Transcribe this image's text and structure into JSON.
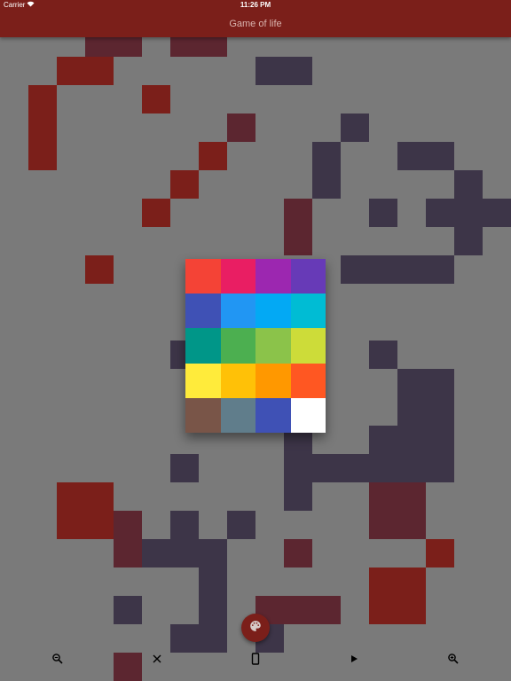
{
  "status_bar": {
    "carrier": "Carrier",
    "time": "11:26 PM",
    "wifi_icon": "wifi-icon"
  },
  "app_bar": {
    "title": "Game of life"
  },
  "colors": {
    "bar": "#7b1f1a",
    "background": "#7a7a7a",
    "red_cell": "#7b1f1a",
    "purple_cell": "#3d3548",
    "dark_red_cell": "#5c2630"
  },
  "board": {
    "cell_size": 32,
    "cells": [
      [
        "dark_red_cell",
        3,
        1
      ],
      [
        "dark_red_cell",
        4,
        1
      ],
      [
        "dark_red_cell",
        6,
        1
      ],
      [
        "dark_red_cell",
        7,
        1
      ],
      [
        "red_cell",
        2,
        2
      ],
      [
        "red_cell",
        3,
        2
      ],
      [
        "purple_cell",
        9,
        2
      ],
      [
        "purple_cell",
        10,
        2
      ],
      [
        "red_cell",
        1,
        3
      ],
      [
        "red_cell",
        5,
        3
      ],
      [
        "red_cell",
        1,
        4
      ],
      [
        "dark_red_cell",
        8,
        4
      ],
      [
        "purple_cell",
        12,
        4
      ],
      [
        "red_cell",
        1,
        5
      ],
      [
        "red_cell",
        7,
        5
      ],
      [
        "purple_cell",
        11,
        5
      ],
      [
        "purple_cell",
        14,
        5
      ],
      [
        "purple_cell",
        15,
        5
      ],
      [
        "red_cell",
        6,
        6
      ],
      [
        "purple_cell",
        11,
        6
      ],
      [
        "purple_cell",
        16,
        6
      ],
      [
        "red_cell",
        5,
        7
      ],
      [
        "dark_red_cell",
        10,
        7
      ],
      [
        "purple_cell",
        13,
        7
      ],
      [
        "purple_cell",
        15,
        7
      ],
      [
        "purple_cell",
        16,
        7
      ],
      [
        "purple_cell",
        17,
        7
      ],
      [
        "dark_red_cell",
        10,
        8
      ],
      [
        "purple_cell",
        16,
        8
      ],
      [
        "red_cell",
        3,
        9
      ],
      [
        "purple_cell",
        12,
        9
      ],
      [
        "purple_cell",
        13,
        9
      ],
      [
        "purple_cell",
        14,
        9
      ],
      [
        "purple_cell",
        15,
        9
      ],
      [
        "purple_cell",
        6,
        12
      ],
      [
        "purple_cell",
        13,
        12
      ],
      [
        "purple_cell",
        14,
        13
      ],
      [
        "purple_cell",
        15,
        13
      ],
      [
        "purple_cell",
        14,
        14
      ],
      [
        "purple_cell",
        15,
        14
      ],
      [
        "purple_cell",
        10,
        15
      ],
      [
        "purple_cell",
        13,
        15
      ],
      [
        "purple_cell",
        14,
        15
      ],
      [
        "purple_cell",
        15,
        15
      ],
      [
        "purple_cell",
        6,
        16
      ],
      [
        "purple_cell",
        10,
        16
      ],
      [
        "purple_cell",
        11,
        16
      ],
      [
        "purple_cell",
        12,
        16
      ],
      [
        "purple_cell",
        13,
        16
      ],
      [
        "purple_cell",
        14,
        16
      ],
      [
        "purple_cell",
        15,
        16
      ],
      [
        "red_cell",
        2,
        17
      ],
      [
        "red_cell",
        3,
        17
      ],
      [
        "purple_cell",
        10,
        17
      ],
      [
        "dark_red_cell",
        13,
        17
      ],
      [
        "dark_red_cell",
        14,
        17
      ],
      [
        "red_cell",
        2,
        18
      ],
      [
        "red_cell",
        3,
        18
      ],
      [
        "dark_red_cell",
        4,
        18
      ],
      [
        "purple_cell",
        6,
        18
      ],
      [
        "purple_cell",
        8,
        18
      ],
      [
        "dark_red_cell",
        13,
        18
      ],
      [
        "dark_red_cell",
        14,
        18
      ],
      [
        "dark_red_cell",
        4,
        19
      ],
      [
        "purple_cell",
        5,
        19
      ],
      [
        "purple_cell",
        6,
        19
      ],
      [
        "purple_cell",
        7,
        19
      ],
      [
        "dark_red_cell",
        10,
        19
      ],
      [
        "red_cell",
        15,
        19
      ],
      [
        "purple_cell",
        7,
        20
      ],
      [
        "red_cell",
        13,
        20
      ],
      [
        "red_cell",
        14,
        20
      ],
      [
        "purple_cell",
        4,
        21
      ],
      [
        "purple_cell",
        7,
        21
      ],
      [
        "dark_red_cell",
        9,
        21
      ],
      [
        "dark_red_cell",
        10,
        21
      ],
      [
        "dark_red_cell",
        11,
        21
      ],
      [
        "red_cell",
        13,
        21
      ],
      [
        "red_cell",
        14,
        21
      ],
      [
        "purple_cell",
        6,
        22
      ],
      [
        "purple_cell",
        7,
        22
      ],
      [
        "purple_cell",
        9,
        22
      ],
      [
        "dark_red_cell",
        4,
        23
      ]
    ]
  },
  "palette": {
    "swatches": [
      "#f44336",
      "#e91e63",
      "#9c27b0",
      "#673ab7",
      "#3f51b5",
      "#2196f3",
      "#03a9f4",
      "#00bcd4",
      "#009688",
      "#4caf50",
      "#8bc34a",
      "#cddc39",
      "#ffeb3b",
      "#ffc107",
      "#ff9800",
      "#ff5722",
      "#795548",
      "#607d8b",
      "#3f51b5",
      "#ffffff"
    ]
  },
  "fab": {
    "icon": "palette-icon"
  },
  "toolbar": {
    "items": [
      {
        "name": "zoom-out-button",
        "icon": "magnifier-minus-icon"
      },
      {
        "name": "clear-button",
        "icon": "close-icon"
      },
      {
        "name": "device-button",
        "icon": "phone-icon"
      },
      {
        "name": "play-button",
        "icon": "play-icon"
      },
      {
        "name": "zoom-in-button",
        "icon": "magnifier-plus-icon"
      }
    ]
  }
}
